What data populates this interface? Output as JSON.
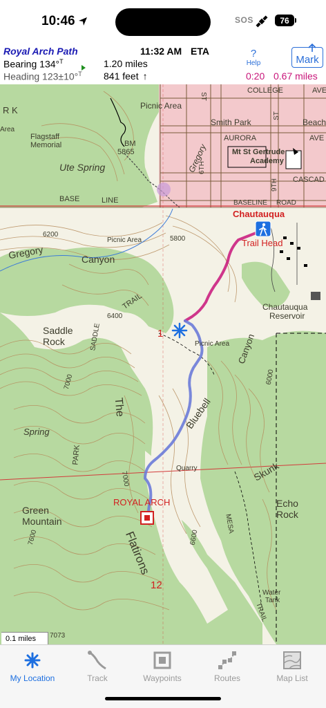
{
  "status": {
    "time": "10:46",
    "sos": "SOS",
    "battery": "76"
  },
  "header": {
    "path_name": "Royal Arch Path",
    "bearing_label": "Bearing",
    "bearing_value": "134°",
    "bearing_unit": "T",
    "heading_label": "Heading",
    "heading_value": "123±10°",
    "heading_unit": "T",
    "eta_time": "11:32 AM",
    "eta_label": "ETA",
    "distance": "1.20 miles",
    "elevation": "841 feet",
    "elevation_arrow": "↑",
    "help_label": "Help",
    "help_glyph": "?",
    "mark_label": "Mark",
    "eta_duration": "0:20",
    "eta_remaining": "0.67 miles"
  },
  "map": {
    "labels": {
      "picnic_area_top": "Picnic Area",
      "college": "COLLEGE",
      "ave_top": "AVE",
      "smith_park": "Smith Park",
      "beach": "Beach",
      "aurora": "AURORA",
      "ave_mid": "AVE",
      "mt_st_gertrude": "Mt St Gertrude",
      "academy": "Academy",
      "cascade": "CASCAD",
      "st_a": "ST",
      "st_b": "ST",
      "sixth": "6TH",
      "ninth": "9TH",
      "gregory_road": "Gregory",
      "rk": "R K",
      "area": "Area",
      "flagstaff": "Flagstaff",
      "memorial": "Memorial",
      "bm": "BM",
      "bm_elev": "5865",
      "ute_spring": "Ute Spring",
      "base": "BASE",
      "line": "LINE",
      "baseline": "BASELINE",
      "road": "ROAD",
      "chautauqua": "Chautauqua",
      "trail_head": "Trail Head",
      "gregory": "Gregory",
      "canyon": "Canyon",
      "picnic_area_mid": "Picnic Area",
      "elev_6200": "6200",
      "elev_5800": "5800",
      "elev_6400": "6400",
      "elev_7000": "7000",
      "elev_6000": "6000",
      "elev_6600": "6600",
      "elev_7600": "7600",
      "elev_7073": "7073",
      "trail_mid": "TRAIL",
      "chautauqua_res": "Chautauqua",
      "reservoir": "Reservoir",
      "saddle": "Saddle",
      "rock": "Rock",
      "picnic_area_low": "Picnic Area",
      "canyon_east": "Canyon",
      "bluebell": "Bluebell",
      "the": "The",
      "spring": "Spring",
      "park": "PARK",
      "quarry": "Quarry",
      "skunk": "Skunk",
      "royal_arch": "ROYAL ARCH",
      "echo": "Echo",
      "echo_rock": "Rock",
      "green": "Green",
      "mountain": "Mountain",
      "flatirons": "Flatirons",
      "mesa": "MESA",
      "water_tank": "Water",
      "tank": "Tank",
      "trail_low": "TRAIL",
      "section_1": "1",
      "section_12": "12",
      "saddle_ridge": "SADDLE"
    },
    "scale": "0.1 miles"
  },
  "tabs": [
    {
      "label": "My Location",
      "icon": "star-location-icon",
      "active": true
    },
    {
      "label": "Track",
      "icon": "track-icon",
      "active": false
    },
    {
      "label": "Waypoints",
      "icon": "waypoint-icon",
      "active": false
    },
    {
      "label": "Routes",
      "icon": "routes-icon",
      "active": false
    },
    {
      "label": "Map List",
      "icon": "map-list-icon",
      "active": false
    }
  ],
  "colors": {
    "accent": "#1d6fe0",
    "track": "#c8157a",
    "route": "#6b7bd8",
    "vegetation": "#b7d9a0",
    "urban": "#f3c9cc",
    "contour": "#b58a5a"
  }
}
